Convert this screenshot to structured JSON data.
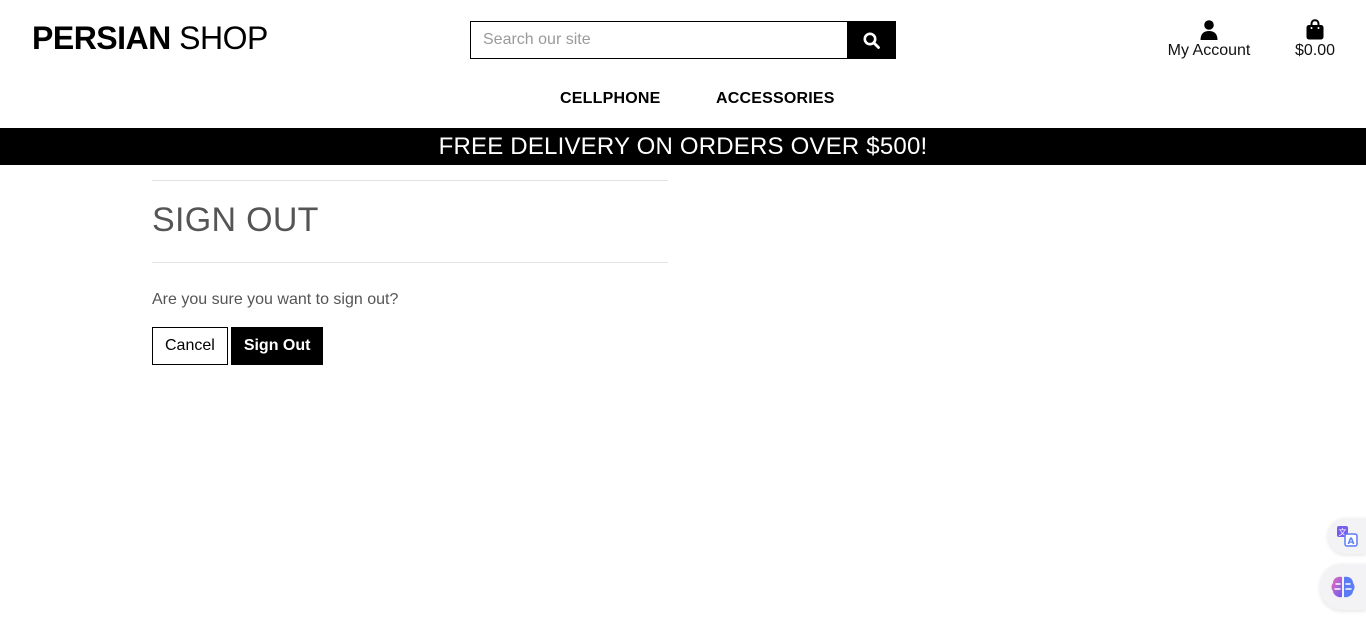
{
  "brand": {
    "bold": "PERSIAN",
    "light": " SHOP"
  },
  "search": {
    "placeholder": "Search our site",
    "icon": "search-icon"
  },
  "account": {
    "label": "My Account",
    "icon": "user-icon"
  },
  "cart": {
    "total": "$0.00",
    "icon": "shopping-bag-icon"
  },
  "nav": {
    "items": [
      {
        "label": "CELLPHONE"
      },
      {
        "label": "ACCESSORIES"
      }
    ]
  },
  "banner": {
    "text": "FREE DELIVERY ON ORDERS OVER $500!"
  },
  "page": {
    "title": "SIGN OUT",
    "message": "Are you sure you want to sign out?",
    "cancel_label": "Cancel",
    "signout_label": "Sign Out"
  },
  "floating": {
    "translate_icon": "translate-icon",
    "assistant_icon": "brain-icon"
  },
  "colors": {
    "primary": "#000000",
    "banner_text": "#ffffff",
    "muted_text": "#555555"
  }
}
